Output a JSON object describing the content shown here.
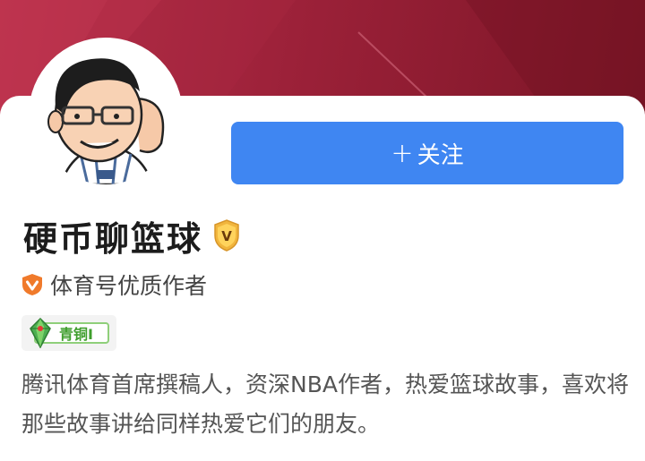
{
  "profile": {
    "name": "硬币聊篮球",
    "verified_badge_letter": "V",
    "certification": "体育号优质作者",
    "level_label": "青铜I",
    "bio": "腾讯体育首席撰稿人，资深NBA作者，热爱篮球故事，喜欢将那些故事讲给同样热爱它们的朋友。"
  },
  "follow_button": {
    "plus": "+",
    "label": "关注"
  },
  "colors": {
    "banner": "#9c2139",
    "follow_button": "#3f86f2",
    "badge_gold": "#f1b53d",
    "cert_orange": "#f07a2b",
    "level_green": "#3f9e2d"
  },
  "icons": [
    "verified-v-badge-icon",
    "certification-shield-icon",
    "bronze-gem-icon"
  ]
}
